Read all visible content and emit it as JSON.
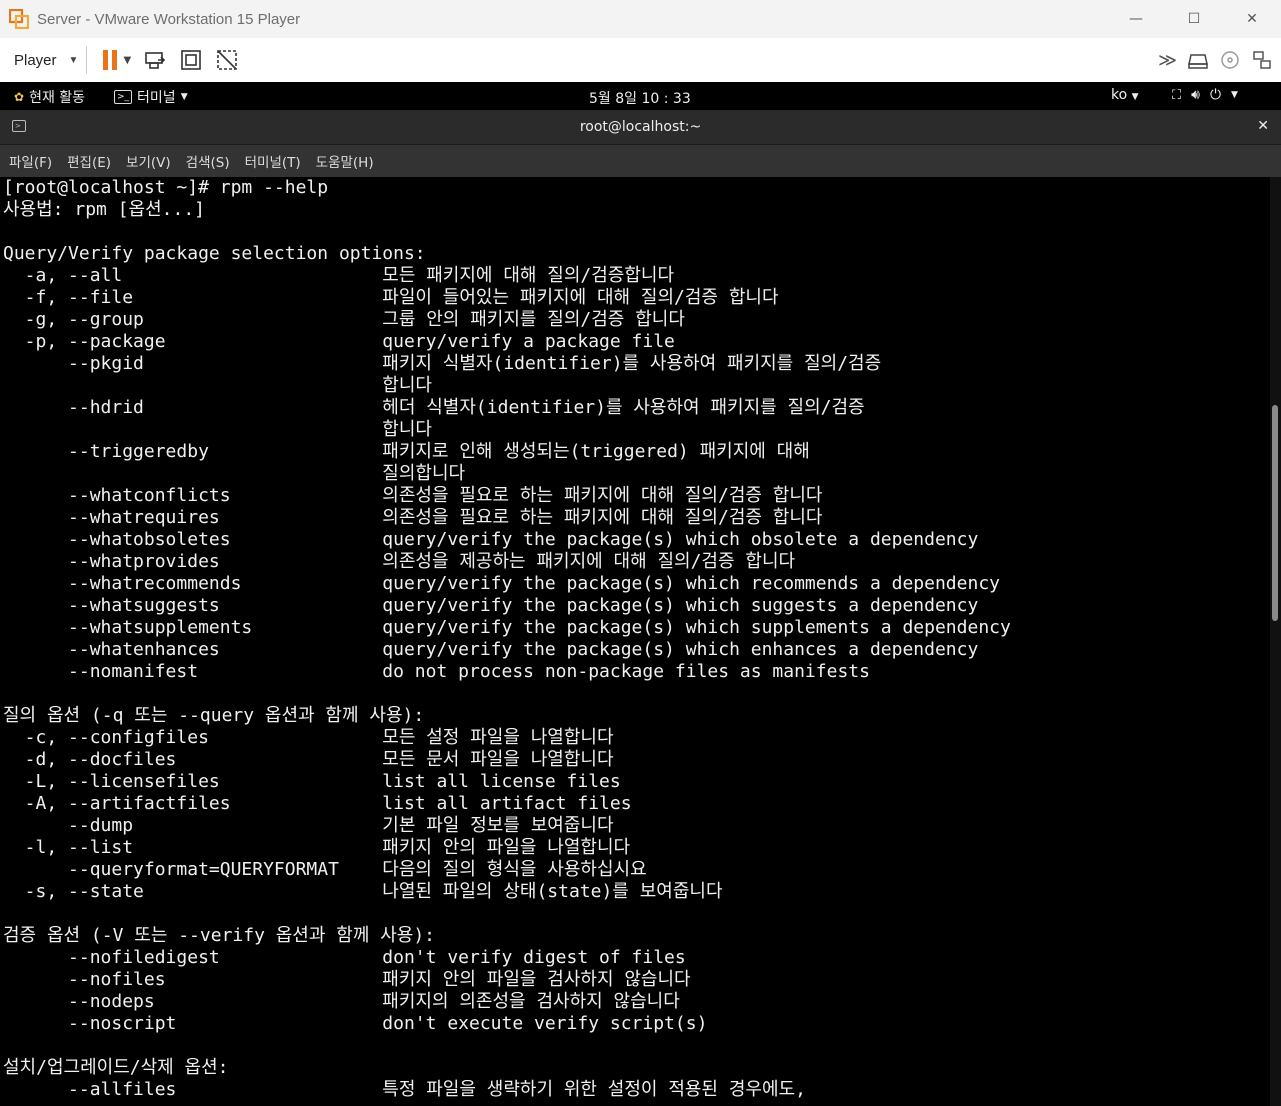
{
  "window": {
    "title": "Server - VMware Workstation 15 Player",
    "minimize": "—",
    "maximize": "☐",
    "close": "✕"
  },
  "toolbar": {
    "player_label": "Player"
  },
  "gnome": {
    "activities": "현재 활동",
    "app_menu": "터미널",
    "clock": "5월 8일 10 : 33",
    "lang": "ko"
  },
  "terminal": {
    "title": "root@localhost:~",
    "menu": [
      "파일(F)",
      "편집(E)",
      "보기(V)",
      "검색(S)",
      "터미널(T)",
      "도움말(H)"
    ],
    "lines": [
      "[root@localhost ~]# rpm --help",
      "사용법: rpm [옵션...]",
      "",
      "Query/Verify package selection options:",
      "  -a, --all                        모든 패키지에 대해 질의/검증합니다",
      "  -f, --file                       파일이 들어있는 패키지에 대해 질의/검증 합니다",
      "  -g, --group                      그룹 안의 패키지를 질의/검증 합니다",
      "  -p, --package                    query/verify a package file",
      "      --pkgid                      패키지 식별자(identifier)를 사용하여 패키지를 질의/검증",
      "                                   합니다",
      "      --hdrid                      헤더 식별자(identifier)를 사용하여 패키지를 질의/검증",
      "                                   합니다",
      "      --triggeredby                패키지로 인해 생성되는(triggered) 패키지에 대해",
      "                                   질의합니다",
      "      --whatconflicts              의존성을 필요로 하는 패키지에 대해 질의/검증 합니다",
      "      --whatrequires               의존성을 필요로 하는 패키지에 대해 질의/검증 합니다",
      "      --whatobsoletes              query/verify the package(s) which obsolete a dependency",
      "      --whatprovides               의존성을 제공하는 패키지에 대해 질의/검증 합니다",
      "      --whatrecommends             query/verify the package(s) which recommends a dependency",
      "      --whatsuggests               query/verify the package(s) which suggests a dependency",
      "      --whatsupplements            query/verify the package(s) which supplements a dependency",
      "      --whatenhances               query/verify the package(s) which enhances a dependency",
      "      --nomanifest                 do not process non-package files as manifests",
      "",
      "질의 옵션 (-q 또는 --query 옵션과 함께 사용):",
      "  -c, --configfiles                모든 설정 파일을 나열합니다",
      "  -d, --docfiles                   모든 문서 파일을 나열합니다",
      "  -L, --licensefiles               list all license files",
      "  -A, --artifactfiles              list all artifact files",
      "      --dump                       기본 파일 정보를 보여줍니다",
      "  -l, --list                       패키지 안의 파일을 나열합니다",
      "      --queryformat=QUERYFORMAT    다음의 질의 형식을 사용하십시요",
      "  -s, --state                      나열된 파일의 상태(state)를 보여줍니다",
      "",
      "검증 옵션 (-V 또는 --verify 옵션과 함께 사용):",
      "      --nofiledigest               don't verify digest of files",
      "      --nofiles                    패키지 안의 파일을 검사하지 않습니다",
      "      --nodeps                     패키지의 의존성을 검사하지 않습니다",
      "      --noscript                   don't execute verify script(s)",
      "",
      "설치/업그레이드/삭제 옵션:",
      "      --allfiles                   특정 파일을 생략하기 위한 설정이 적용된 경우에도,"
    ]
  }
}
